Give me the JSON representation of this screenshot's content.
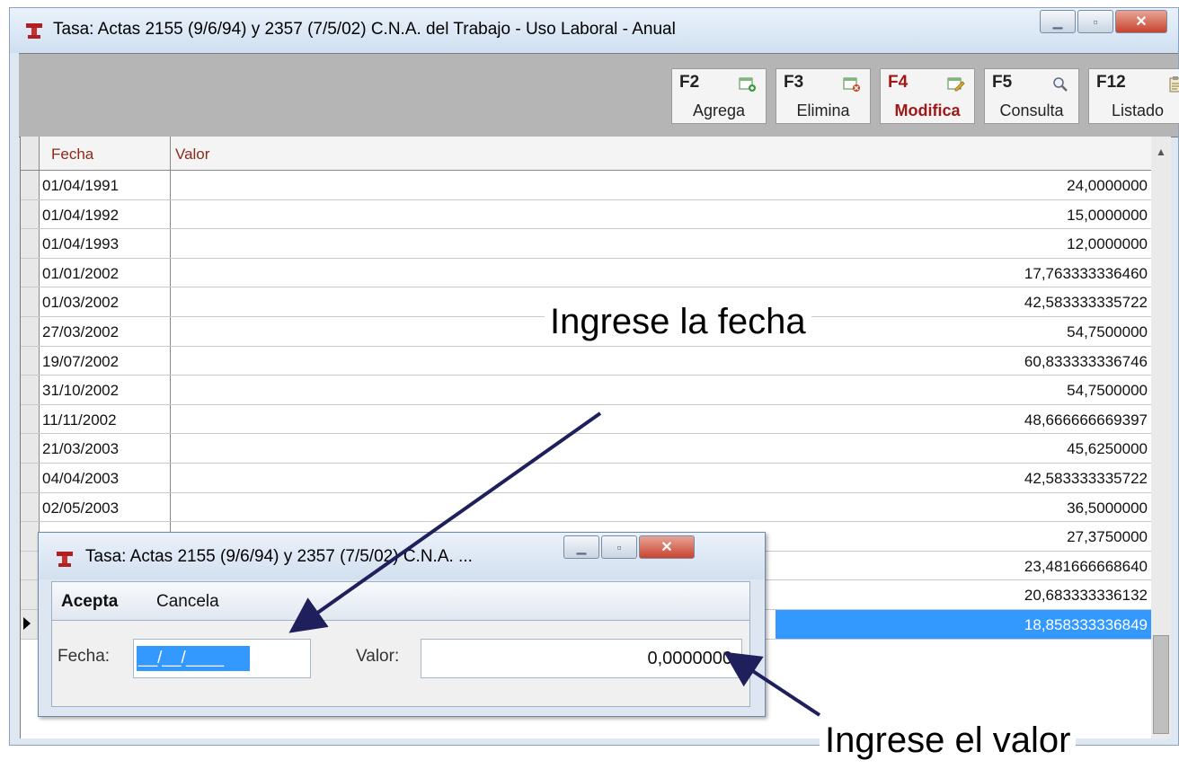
{
  "window": {
    "title": "Tasa: Actas 2155 (9/6/94) y 2357 (7/5/02) C.N.A. del Trabajo  - Uso Laboral - Anual",
    "controls": [
      "minimize",
      "maximize",
      "close"
    ]
  },
  "toolbar": {
    "buttons": [
      {
        "key": "F2",
        "label": "Agrega",
        "icon": "add-record-icon"
      },
      {
        "key": "F3",
        "label": "Elimina",
        "icon": "delete-record-icon"
      },
      {
        "key": "F4",
        "label": "Modifica",
        "icon": "edit-record-icon",
        "active": true
      },
      {
        "key": "F5",
        "label": "Consulta",
        "icon": "magnifier-icon"
      },
      {
        "key": "F12",
        "label": "Listado",
        "icon": "clipboard-icon"
      }
    ]
  },
  "grid": {
    "columns": [
      "Fecha",
      "Valor"
    ],
    "rows": [
      {
        "fecha": "01/04/1991",
        "valor": "24,0000000"
      },
      {
        "fecha": "01/04/1992",
        "valor": "15,0000000"
      },
      {
        "fecha": "01/04/1993",
        "valor": "12,0000000"
      },
      {
        "fecha": "01/01/2002",
        "valor": "17,763333336460"
      },
      {
        "fecha": "01/03/2002",
        "valor": "42,583333335722"
      },
      {
        "fecha": "27/03/2002",
        "valor": "54,7500000"
      },
      {
        "fecha": "19/07/2002",
        "valor": "60,833333336746"
      },
      {
        "fecha": "31/10/2002",
        "valor": "54,7500000"
      },
      {
        "fecha": "11/11/2002",
        "valor": "48,666666669397"
      },
      {
        "fecha": "21/03/2003",
        "valor": "45,6250000"
      },
      {
        "fecha": "04/04/2003",
        "valor": "42,583333335722"
      },
      {
        "fecha": "02/05/2003",
        "valor": "36,5000000"
      },
      {
        "fecha": "",
        "valor": "27,3750000"
      },
      {
        "fecha": "",
        "valor": "23,481666668640"
      },
      {
        "fecha": "",
        "valor": "20,683333336132"
      },
      {
        "fecha": "",
        "valor": "18,858333336849",
        "selected": true
      }
    ]
  },
  "dialog": {
    "title": "Tasa: Actas 2155 (9/6/94) y 2357 (7/5/02) C.N.A. ...",
    "menu": {
      "accept": "Acepta",
      "cancel": "Cancela"
    },
    "fecha_label": "Fecha:",
    "fecha_value": "__/__/____",
    "valor_label": "Valor:",
    "valor_value": "0,0000000"
  },
  "annotations": {
    "fecha_hint": "Ingrese la fecha",
    "valor_hint": "Ingrese el valor"
  },
  "colors": {
    "selection": "#3399ff",
    "header_text": "#8b2a1a",
    "active_button": "#a01818",
    "arrow": "#1f1f5c"
  }
}
